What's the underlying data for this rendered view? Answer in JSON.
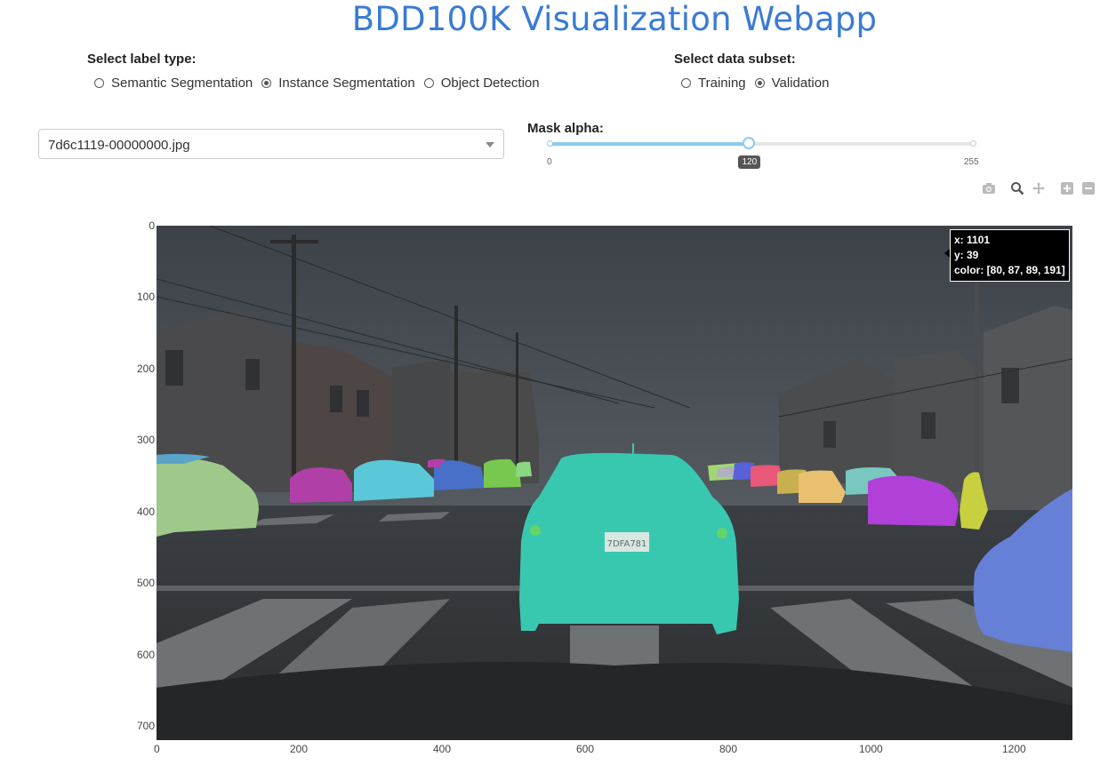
{
  "page": {
    "title": "BDD100K Visualization Webapp"
  },
  "label_type": {
    "heading": "Select label type:",
    "options": [
      {
        "label": "Semantic Segmentation",
        "selected": false
      },
      {
        "label": "Instance Segmentation",
        "selected": true
      },
      {
        "label": "Object Detection",
        "selected": false
      }
    ]
  },
  "data_subset": {
    "heading": "Select data subset:",
    "options": [
      {
        "label": "Training",
        "selected": false
      },
      {
        "label": "Validation",
        "selected": true
      }
    ]
  },
  "image_select": {
    "value": "7d6c1119-00000000.jpg"
  },
  "mask_alpha": {
    "heading": "Mask alpha:",
    "min": "0",
    "max": "255",
    "value": "120"
  },
  "modebar": {
    "icons": [
      "camera-icon",
      "zoom-icon",
      "pan-icon",
      "zoom-in-icon",
      "zoom-out-icon"
    ]
  },
  "axes": {
    "y_ticks": [
      "0",
      "100",
      "200",
      "300",
      "400",
      "500",
      "600",
      "700"
    ],
    "x_ticks": [
      "0",
      "200",
      "400",
      "600",
      "800",
      "1000",
      "1200"
    ]
  },
  "hover": {
    "x": "x: 1101",
    "y": "y: 39",
    "color": "color: [80, 87, 89, 191]"
  },
  "colors": {
    "accent": "#3a7bd5",
    "slider": "#8ecbef"
  }
}
